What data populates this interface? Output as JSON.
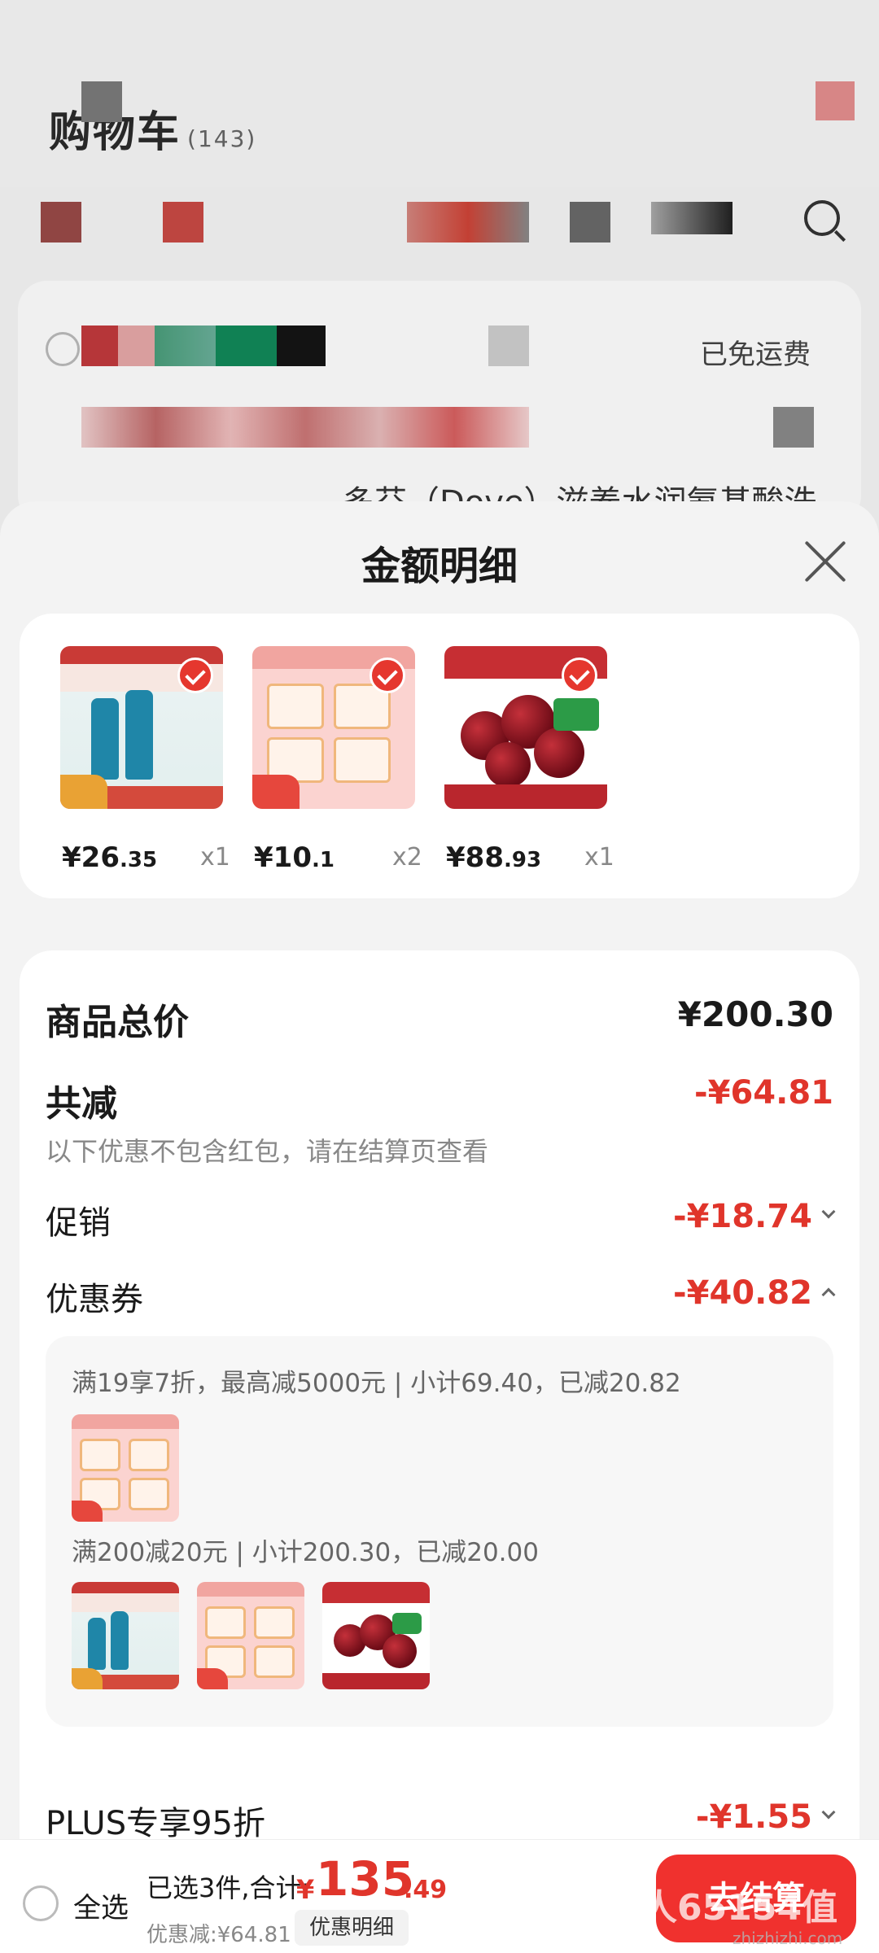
{
  "background": {
    "page_title": "购物车",
    "item_count": "(143)",
    "shipping_note": "已免运费",
    "product_snippet": "多芬（Dove）滋养水润氨基酸洗"
  },
  "sheet": {
    "title": "金额明细"
  },
  "products": [
    {
      "name": "dove",
      "price_int": "¥26",
      "price_dec": ".35",
      "qty": "x1"
    },
    {
      "name": "libai",
      "price_int": "¥10",
      "price_dec": ".1",
      "qty": "x2"
    },
    {
      "name": "cherry",
      "price_int": "¥88",
      "price_dec": ".93",
      "qty": "x1"
    }
  ],
  "summary": {
    "total_label": "商品总价",
    "total_value": "¥200.30",
    "discount_label": "共减",
    "discount_value": "-¥64.81",
    "discount_hint": "以下优惠不包含红包，请在结算页查看",
    "promo_label": "促销",
    "promo_value": "-¥18.74",
    "coupon_label": "优惠券",
    "coupon_value": "-¥40.82",
    "coupon_line1": "满19享7折，最高减5000元 | 小计69.40，已减20.82",
    "coupon_line2": "满200减20元 | 小计200.30，已减20.00",
    "plus_label": "PLUS专享95折",
    "plus_value": "-¥1.55"
  },
  "bottom": {
    "select_all": "全选",
    "selected_text": "已选3件,合计:",
    "currency": "¥",
    "total_int": "135",
    "total_dec": ".49",
    "saved_text": "优惠减:¥64.81",
    "detail_button": "优惠明细",
    "checkout_button": "去结算",
    "watermark": "慢星人65154值",
    "watermark_site": "zhizhizhi.com"
  }
}
